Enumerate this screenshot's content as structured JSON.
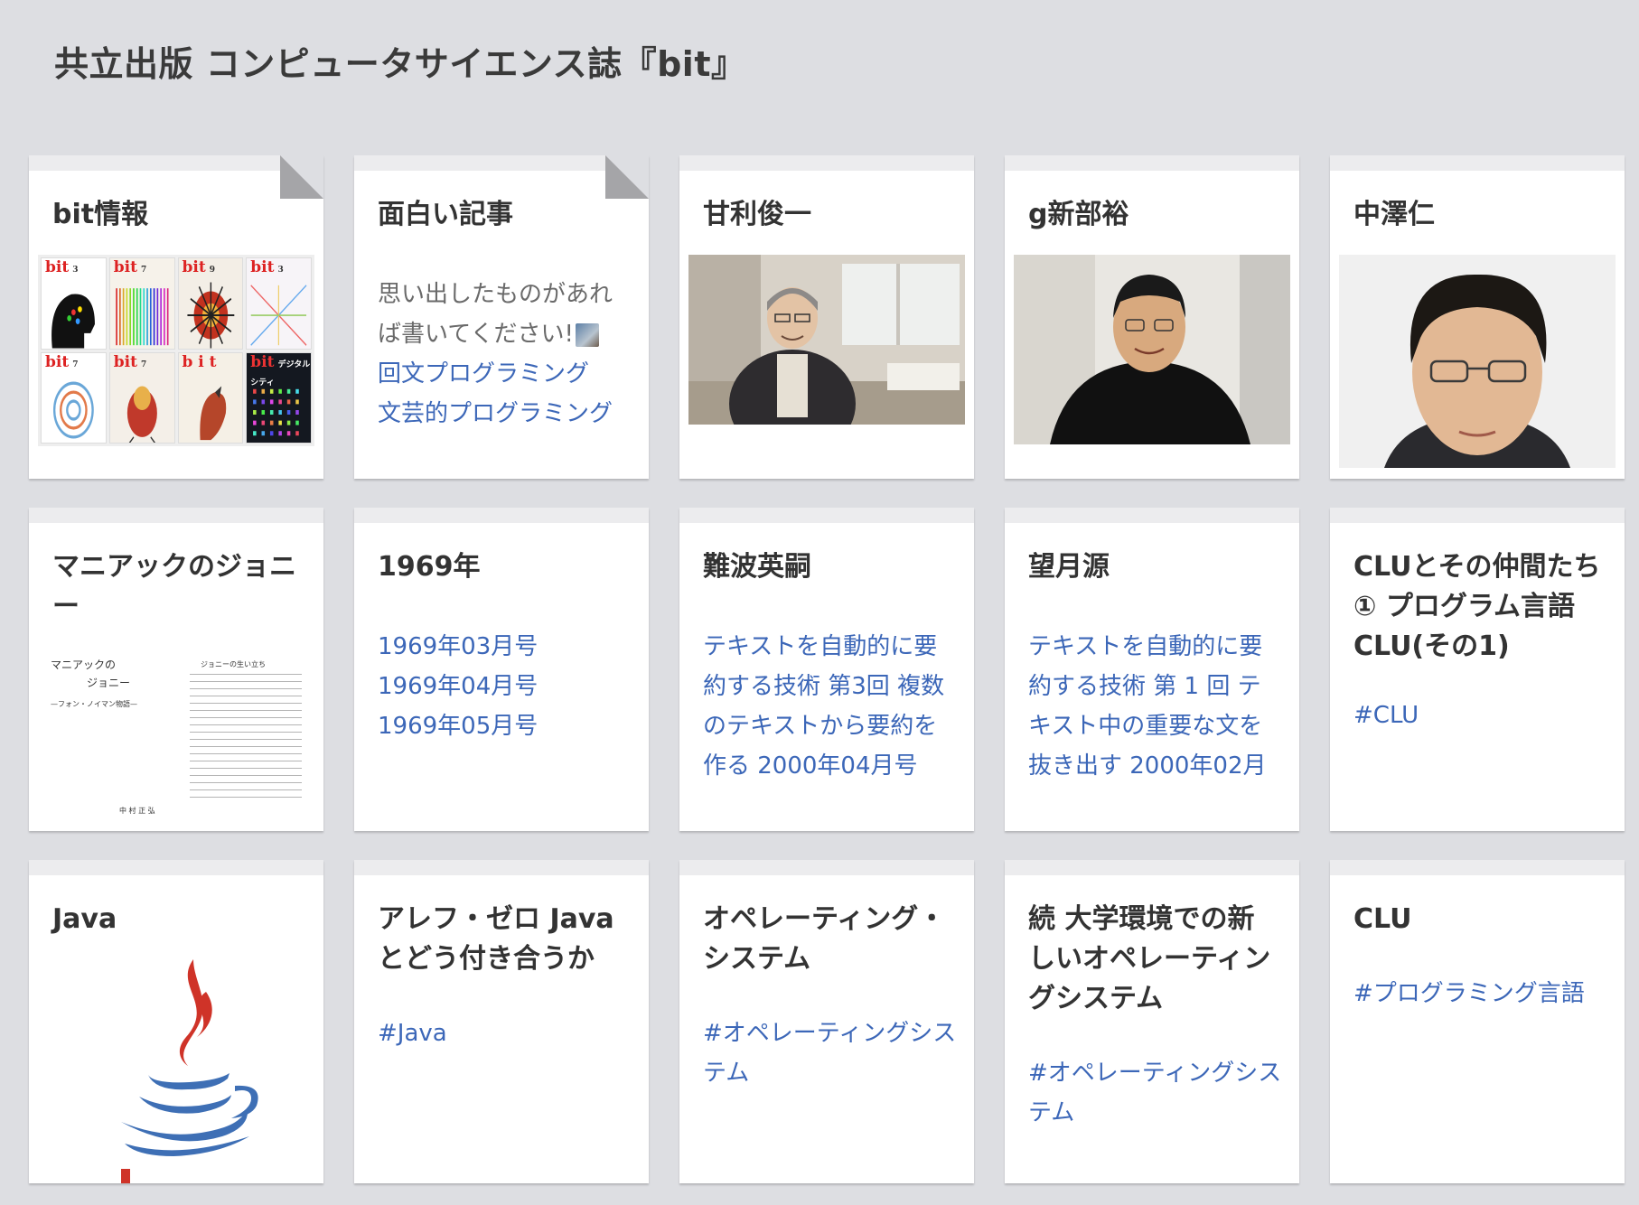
{
  "page": {
    "title": "共立出版 コンピュータサイエンス誌『bit』"
  },
  "cards": [
    {
      "title": "bit情報"
    },
    {
      "title": "面白い記事",
      "text": [
        "思い出したものがあれ",
        "ば書いてください!"
      ],
      "links": [
        "回文プログラミング",
        "文芸的プログラミング"
      ]
    },
    {
      "title": "甘利俊一"
    },
    {
      "title": "g新部裕"
    },
    {
      "title": "中澤仁"
    },
    {
      "title": "マニアックのジョニー",
      "scan": {
        "heading": "マニアックの",
        "heading2": "ジョニー",
        "sub": "—フォン・ノイマン物語—",
        "right_title": "ジョニーの生い立ち",
        "author": "中 村 正 弘"
      }
    },
    {
      "title": "1969年",
      "links": [
        "1969年03月号",
        "1969年04月号",
        "1969年05月号"
      ]
    },
    {
      "title": "難波英嗣",
      "links": [
        "テキストを自動的に要約する技術 第3回 複数のテキストから要約を作る 2000年04月号"
      ]
    },
    {
      "title": "望月源",
      "links": [
        "テキストを自動的に要約する技術 第 1 回 テキスト中の重要な文を抜き出す 2000年02月"
      ]
    },
    {
      "title": "CLUとその仲間たち ① プログラム言語 CLU(その1)",
      "links": [
        "#CLU"
      ]
    },
    {
      "title": "Java"
    },
    {
      "title": "アレフ・ゼロ Java とどう付き合うか",
      "links": [
        "#Java"
      ]
    },
    {
      "title": "オペレーティング・システム",
      "links": [
        "#オペレーティングシステム"
      ]
    },
    {
      "title": "続 大学環境での新しいオペレーティングシステム",
      "links": [
        "#オペレーティングシステム"
      ]
    },
    {
      "title": "CLU",
      "links": [
        "#プログラミング言語"
      ]
    }
  ],
  "covers": [
    {
      "label": "bit",
      "num": "3",
      "bg": "#ffffff"
    },
    {
      "label": "bit",
      "num": "7",
      "bg": "#f6f2ea"
    },
    {
      "label": "bit",
      "num": "9",
      "bg": "#f3eee6"
    },
    {
      "label": "bit",
      "num": "3",
      "bg": "#f7f4f8"
    },
    {
      "label": "bit",
      "num": "7",
      "bg": "#ffffff"
    },
    {
      "label": "bit",
      "num": "7",
      "bg": "#f4efe8"
    },
    {
      "label": "b i t",
      "num": "",
      "bg": "#f5f0e6"
    },
    {
      "label": "bit",
      "num": "デジタルシティ",
      "bg": "#141820"
    }
  ],
  "colors": {
    "link": "#3c67b8",
    "background": "#dddee2",
    "java_red": "#cf3328",
    "java_blue": "#3e6fb5"
  }
}
